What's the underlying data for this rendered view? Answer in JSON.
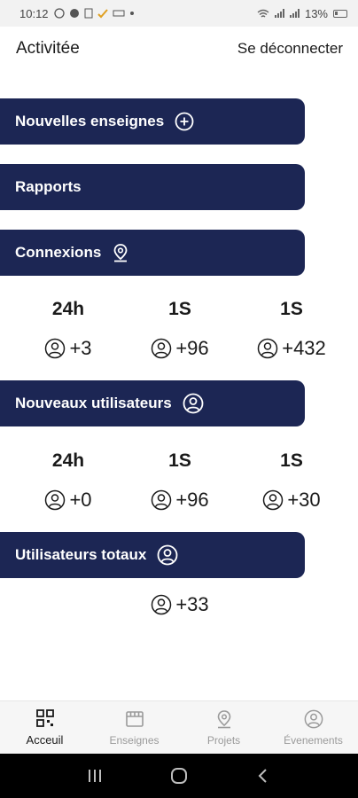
{
  "status_bar": {
    "time": "10:12",
    "battery": "13%"
  },
  "header": {
    "title": "Activitée",
    "logout_label": "Se déconnecter"
  },
  "sections": {
    "new_stores": {
      "label": "Nouvelles enseignes"
    },
    "reports": {
      "label": "Rapports"
    },
    "connections": {
      "label": "Connexions",
      "stats": [
        {
          "period": "24h",
          "value": "+3"
        },
        {
          "period": "1S",
          "value": "+96"
        },
        {
          "period": "1S",
          "value": "+432"
        }
      ]
    },
    "new_users": {
      "label": "Nouveaux utilisateurs",
      "stats": [
        {
          "period": "24h",
          "value": "+0"
        },
        {
          "period": "1S",
          "value": "+96"
        },
        {
          "period": "1S",
          "value": "+30"
        }
      ]
    },
    "total_users": {
      "label": "Utilisateurs totaux",
      "value": "+33"
    }
  },
  "bottom_nav": {
    "items": [
      {
        "label": "Acceuil",
        "icon": "grid-icon",
        "active": true
      },
      {
        "label": "Enseignes",
        "icon": "store-icon",
        "active": false
      },
      {
        "label": "Projets",
        "icon": "map-pin-icon",
        "active": false
      },
      {
        "label": "Évenements",
        "icon": "user-circle-icon",
        "active": false
      }
    ]
  },
  "colors": {
    "bar_bg": "#1c2654",
    "text": "#1a1a1a",
    "inactive": "#9a9a9a"
  }
}
